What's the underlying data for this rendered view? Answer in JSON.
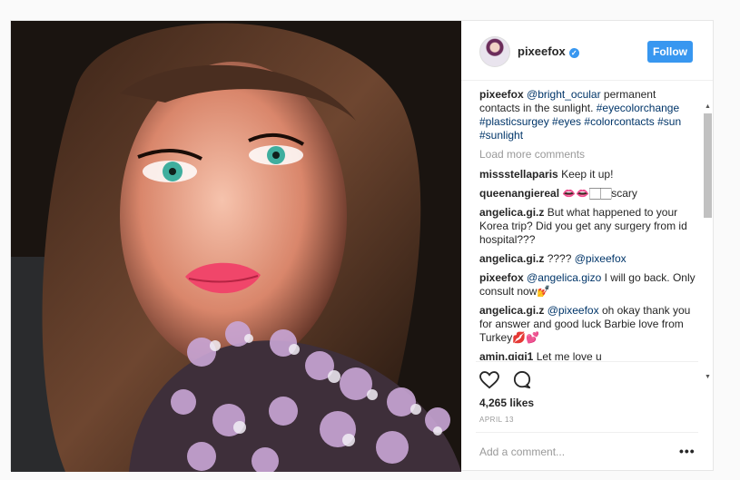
{
  "post": {
    "username": "pixeefox",
    "follow_label": "Follow",
    "caption": {
      "user": "pixeefox",
      "mention": "@bright_ocular",
      "text": " permanent contacts in the sunlight. ",
      "tags": "#eyecolorchange #plasticsurgey #eyes #colorcontacts #sun #sunlight"
    },
    "load_more": "Load more comments",
    "comments": [
      {
        "user": "missstellaparis",
        "mention": "",
        "text": "Keep it up!"
      },
      {
        "user": "queenangiereal",
        "mention": "",
        "text": "👄👄🏻🏻scary"
      },
      {
        "user": "angelica.gi.z",
        "mention": "",
        "text": "But what happened to your Korea trip? Did you get any surgery from id hospital???"
      },
      {
        "user": "angelica.gi.z",
        "mention": "@pixeefox",
        "text": "????"
      },
      {
        "user": "pixeefox",
        "mention": "@angelica.gizo",
        "text": "I will go back. Only consult now💅"
      },
      {
        "user": "angelica.gi.z",
        "mention": "@pixeefox",
        "text": "oh okay thank you for answer and good luck Barbie love from Turkey💋💕"
      },
      {
        "user": "amin.gigi1",
        "mention": "",
        "text": "Let me love u"
      }
    ],
    "likes": "4,265 likes",
    "date": "APRIL 13",
    "add_comment_placeholder": "Add a comment...",
    "more_options": "•••",
    "icons": {
      "like": "heart-icon",
      "comment": "comment-icon",
      "verified": "verified-badge-icon"
    },
    "colors": {
      "accent": "#3897f0",
      "link": "#003569",
      "muted": "#999999"
    }
  }
}
